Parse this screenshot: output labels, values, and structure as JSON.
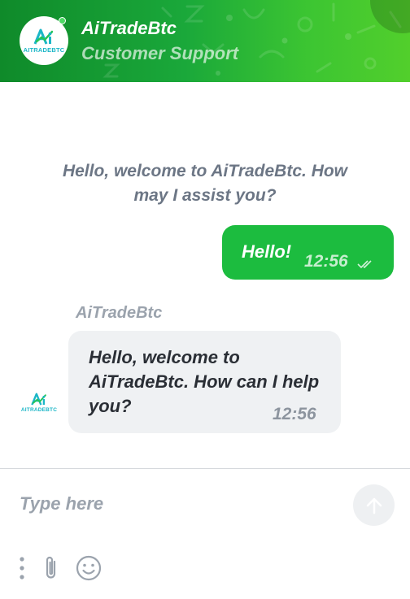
{
  "header": {
    "name": "AiTradeBtc",
    "role": "Customer Support",
    "logo_text": "AITRADEBTC",
    "gradient_start": "#0f8a2a",
    "gradient_end": "#52cf2c",
    "online_color": "#4cd964"
  },
  "chat": {
    "welcome": "Hello, welcome to AiTradeBtc. How may I assist you?",
    "outgoing": {
      "text": "Hello!",
      "time": "12:56",
      "status_icon": "double-check-icon",
      "color": "#1cbc3f"
    },
    "incoming": {
      "sender": "AiTradeBtc",
      "text": "Hello, welcome to AiTradeBtc. How can I help you?",
      "time": "12:56",
      "color": "#eff1f3"
    }
  },
  "composer": {
    "placeholder": "Type here",
    "icons": [
      "more-vertical-icon",
      "paperclip-icon",
      "emoji-icon",
      "send-arrow-icon"
    ]
  }
}
